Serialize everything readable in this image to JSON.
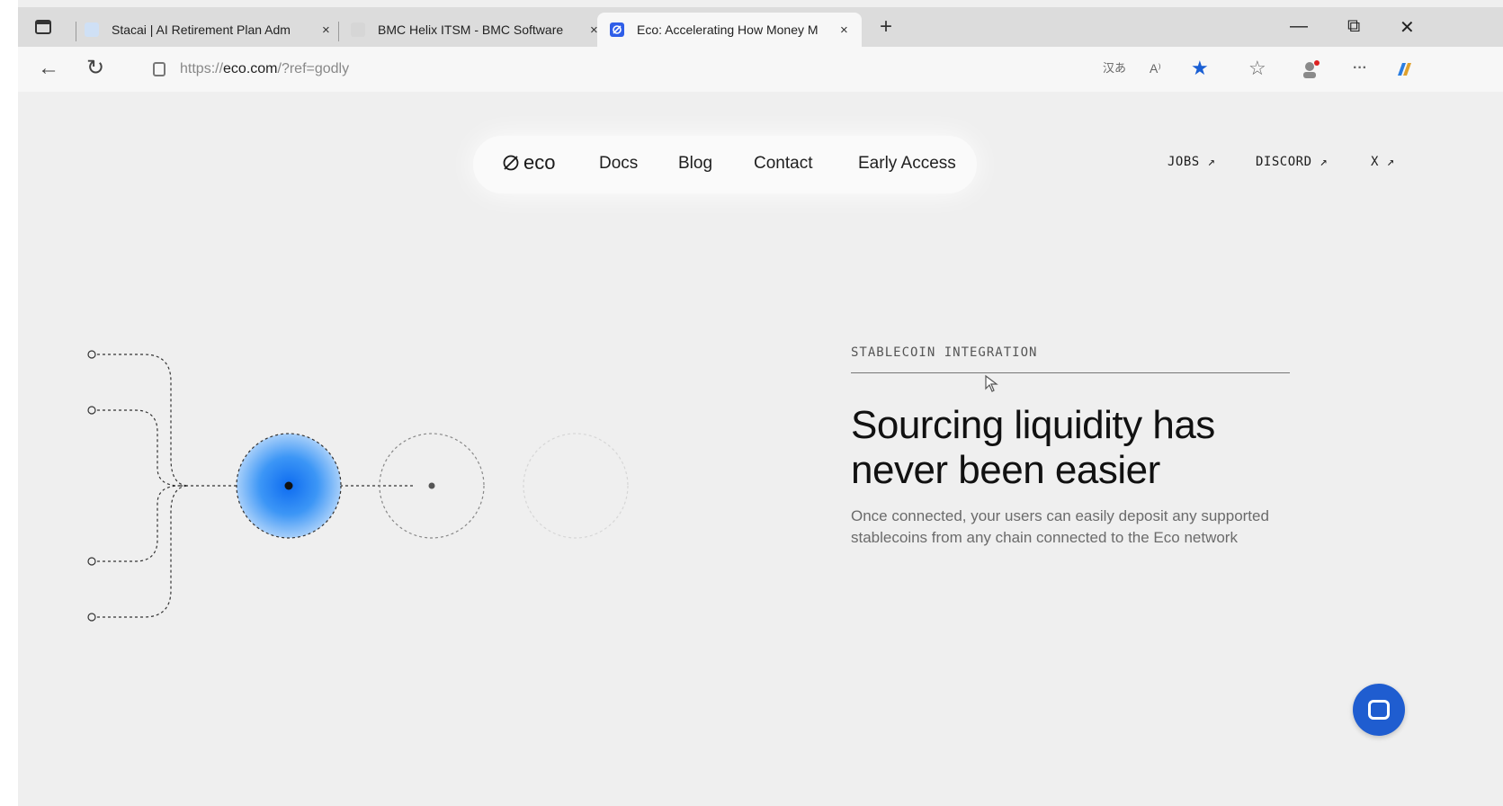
{
  "browser": {
    "tabs": [
      {
        "label": "Stacai | AI Retirement Plan Adm",
        "active": false,
        "favicon_color": "#3a7bd5"
      },
      {
        "label": "BMC Helix ITSM - BMC Software",
        "active": false,
        "favicon_color": "#d0d0d0"
      },
      {
        "label": "Eco: Accelerating How Money M",
        "active": true,
        "favicon_color": "#2f5ee8"
      }
    ],
    "tab_close": "×",
    "new_tab": "+",
    "window_controls": {
      "minimize": "—",
      "restore": "⧉",
      "close": "✕"
    },
    "nav": {
      "back": "←",
      "reload": "↻"
    },
    "url_prefix": "https://",
    "url_domain": "eco.com",
    "url_path": "/?ref=godly",
    "toolbar_icons": [
      "translate-icon",
      "read-aloud-icon",
      "favorite-star-icon",
      "favorites-icon",
      "profile-icon",
      "more-icon",
      "copilot-icon"
    ],
    "toolbar_text": {
      "translate": "汉あ",
      "read_aloud": "A⁾",
      "favorite": "★",
      "favorites": "☆",
      "more": "···"
    }
  },
  "site_nav": {
    "logo_text": "eco",
    "links": [
      "Docs",
      "Blog",
      "Contact",
      "Early Access"
    ],
    "side_links": [
      "JOBS ↗",
      "DISCORD ↗",
      "X ↗"
    ]
  },
  "hero": {
    "eyebrow": "STABLECOIN INTEGRATION",
    "headline_line1": "Sourcing liquidity has",
    "headline_line2": "never been easier",
    "body": "Once connected, your users can easily deposit any supported stablecoins from any chain connected to the Eco network"
  },
  "colors": {
    "accent_blue": "#2f8ff5",
    "chat_button": "#1f5dd0",
    "page_background": "#efefef"
  }
}
